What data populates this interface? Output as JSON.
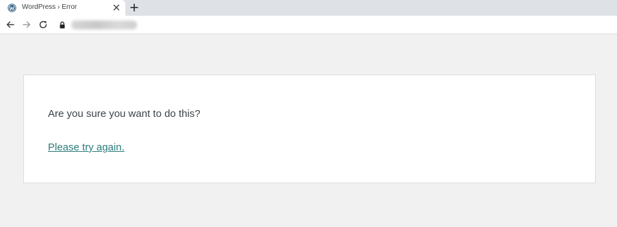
{
  "browser": {
    "tab": {
      "title": "WordPress › Error",
      "favicon": "wordpress-icon"
    },
    "icons": {
      "close": "close-icon",
      "new_tab": "plus-icon",
      "back": "arrow-left-icon",
      "forward": "arrow-right-icon",
      "reload": "reload-icon",
      "secure": "lock-icon"
    },
    "address": {
      "url": ""
    }
  },
  "error": {
    "message": "Are you sure you want to do this?",
    "link_text": "Please try again."
  },
  "colors": {
    "page_background": "#f1f1f1",
    "link": "#2a7a7a",
    "text": "#3c434a",
    "tabstrip": "#dee1e6"
  }
}
